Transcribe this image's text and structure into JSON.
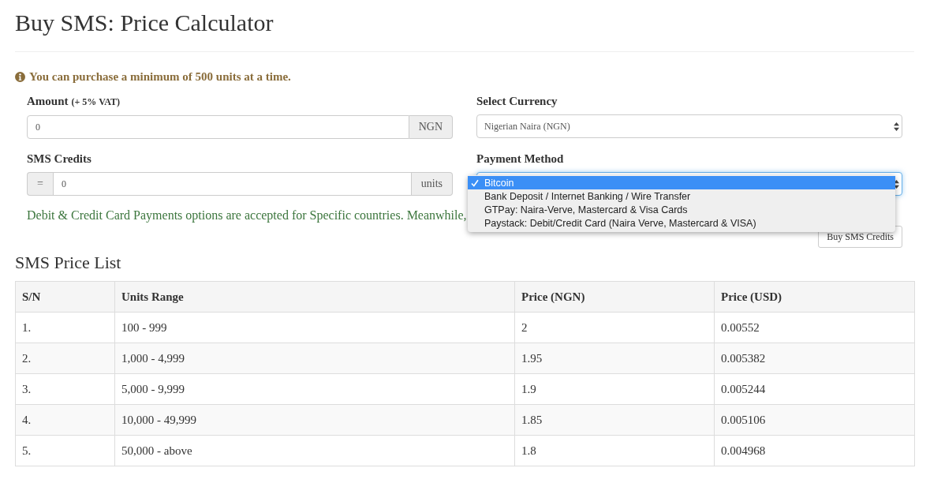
{
  "page": {
    "title": "Buy SMS: Price Calculator"
  },
  "notice": {
    "text": "You can purchase a minimum of 500 units at a time."
  },
  "form": {
    "fields": [
      {
        "kind": "input",
        "label": "Amount",
        "note": "(+ 5% VAT)",
        "value": "0",
        "suffix": "NGN"
      },
      {
        "kind": "select",
        "label": "Select Currency",
        "value": "Nigerian Naira (NGN)"
      },
      {
        "kind": "input",
        "label": "SMS Credits",
        "prefix": "=",
        "value": "0",
        "suffix": "units"
      },
      {
        "kind": "dropdown",
        "label": "Payment Method",
        "expanded": true,
        "options": [
          {
            "label": "Bitcoin",
            "selected": true
          },
          {
            "label": "Bank Deposit / Internet Banking / Wire Transfer",
            "selected": false
          },
          {
            "label": "GTPay: Naira-Verve, Mastercard & Visa Cards",
            "selected": false
          },
          {
            "label": "Paystack: Debit/Credit Card (Naira Verve, Mastercard & VISA)",
            "selected": false
          }
        ]
      }
    ],
    "payment_note": "Debit & Credit Card Payments options are accepted for Specific countries. Meanwhile,",
    "submit_button": "Buy SMS Credits"
  },
  "price_list": {
    "title": "SMS Price List",
    "table": {
      "columns": [
        "S/N",
        "Units Range",
        "Price (NGN)",
        "Price (USD)"
      ],
      "rows": [
        [
          "1.",
          "100 - 999",
          "2",
          "0.00552"
        ],
        [
          "2.",
          "1,000 - 4,999",
          "1.95",
          "0.005382"
        ],
        [
          "3.",
          "5,000 - 9,999",
          "1.9",
          "0.005244"
        ],
        [
          "4.",
          "10,000 - 49,999",
          "1.85",
          "0.005106"
        ],
        [
          "5.",
          "50,000 - above",
          "1.8",
          "0.004968"
        ]
      ]
    }
  }
}
